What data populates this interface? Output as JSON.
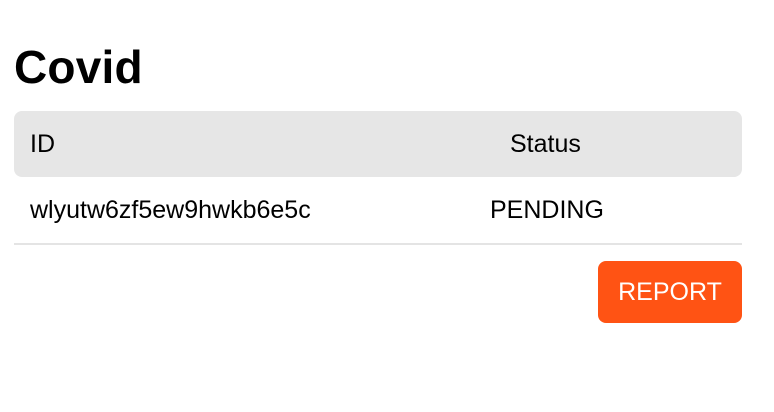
{
  "page": {
    "title": "Covid"
  },
  "table": {
    "headers": {
      "id": "ID",
      "status": "Status"
    },
    "rows": [
      {
        "id": "wlyutw6zf5ew9hwkb6e5c",
        "status": "PENDING"
      }
    ]
  },
  "actions": {
    "report_label": "REPORT"
  },
  "colors": {
    "accent": "#ff5314",
    "header_bg": "#e6e6e6"
  }
}
